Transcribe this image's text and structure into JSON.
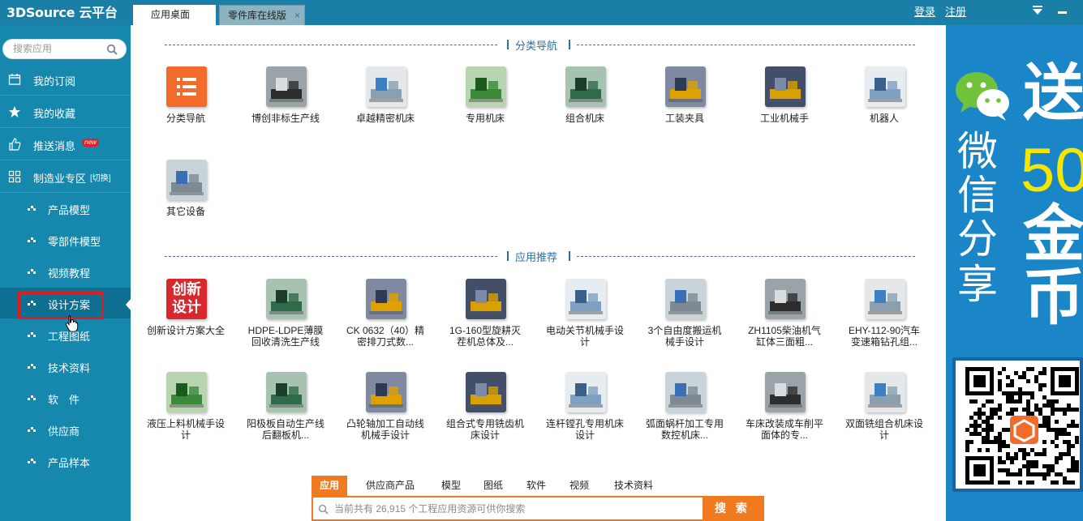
{
  "app": {
    "logo": "3DSource 云平台",
    "tabs": [
      {
        "label": "应用桌面"
      },
      {
        "label": "零件库在线版",
        "close": "×"
      }
    ],
    "links": {
      "login": "登录",
      "register": "注册"
    }
  },
  "sidebar": {
    "search_placeholder": "搜索应用",
    "items": [
      {
        "label": "我的订阅",
        "icon": "calendar-icon"
      },
      {
        "label": "我的收藏",
        "icon": "star-icon"
      },
      {
        "label": "推送消息",
        "icon": "thumbs-up-icon",
        "badge": "new"
      },
      {
        "label": "制造业专区",
        "icon": "grid-icon",
        "extra": "[切换]"
      }
    ],
    "subitems": [
      "产品模型",
      "零部件模型",
      "视频教程",
      "设计方案",
      "工程图纸",
      "技术资料",
      "软　件",
      "供应商",
      "产品样本"
    ],
    "active_subitem": "设计方案"
  },
  "sections": [
    {
      "title": "分类导航"
    },
    {
      "title": "应用推荐"
    }
  ],
  "nav_apps": [
    {
      "name": "分类导航"
    },
    {
      "name": "博创非标生产线"
    },
    {
      "name": "卓越精密机床"
    },
    {
      "name": "专用机床"
    },
    {
      "name": "组合机床"
    },
    {
      "name": "工装夹具"
    },
    {
      "name": "工业机械手"
    },
    {
      "name": "机器人"
    },
    {
      "name": "其它设备"
    }
  ],
  "recommended_apps": [
    {
      "name": "创新设计方案大全",
      "thumb_text": "创新设计"
    },
    {
      "name": "HDPE-LDPE薄膜回收清洗生产线"
    },
    {
      "name": "CK 0632（40）精密排刀式数..."
    },
    {
      "name": "1G-160型旋耕灭茬机总体及..."
    },
    {
      "name": "电动关节机械手设计"
    },
    {
      "name": "3个自由度搬运机械手设计"
    },
    {
      "name": "ZH1105柴油机气缸体三面粗..."
    },
    {
      "name": "EHY-112-90汽车变速箱钻孔组..."
    },
    {
      "name": "液压上料机械手设计"
    },
    {
      "name": "阳极板自动生产线后翻板机..."
    },
    {
      "name": "凸轮轴加工自动线机械手设计"
    },
    {
      "name": "组合式专用铣齿机床设计"
    },
    {
      "name": "连杆镗孔专用机床设计"
    },
    {
      "name": "弧面蜗杆加工专用数控机床..."
    },
    {
      "name": "车床改装成车削平面体的专..."
    },
    {
      "name": "双面铣组合机床设计"
    }
  ],
  "bottom_search": {
    "tabs": [
      "应用",
      "供应商产品",
      "模型",
      "图纸",
      "软件",
      "视频",
      "技术资料"
    ],
    "active_tab": "应用",
    "placeholder": "当前共有 26,915 个工程应用资源可供你搜索",
    "button": "搜 索"
  },
  "ad": {
    "vertical_text": [
      "微",
      "信",
      "分",
      "享"
    ],
    "big_text_1": "送",
    "number": "50",
    "big_text_2": "金",
    "big_text_3": "币"
  },
  "colors": {
    "topbar": "#1a7fa6",
    "sidebar": "#1687ad",
    "accent": "#f07a1f",
    "ad": "#1a86c8"
  }
}
